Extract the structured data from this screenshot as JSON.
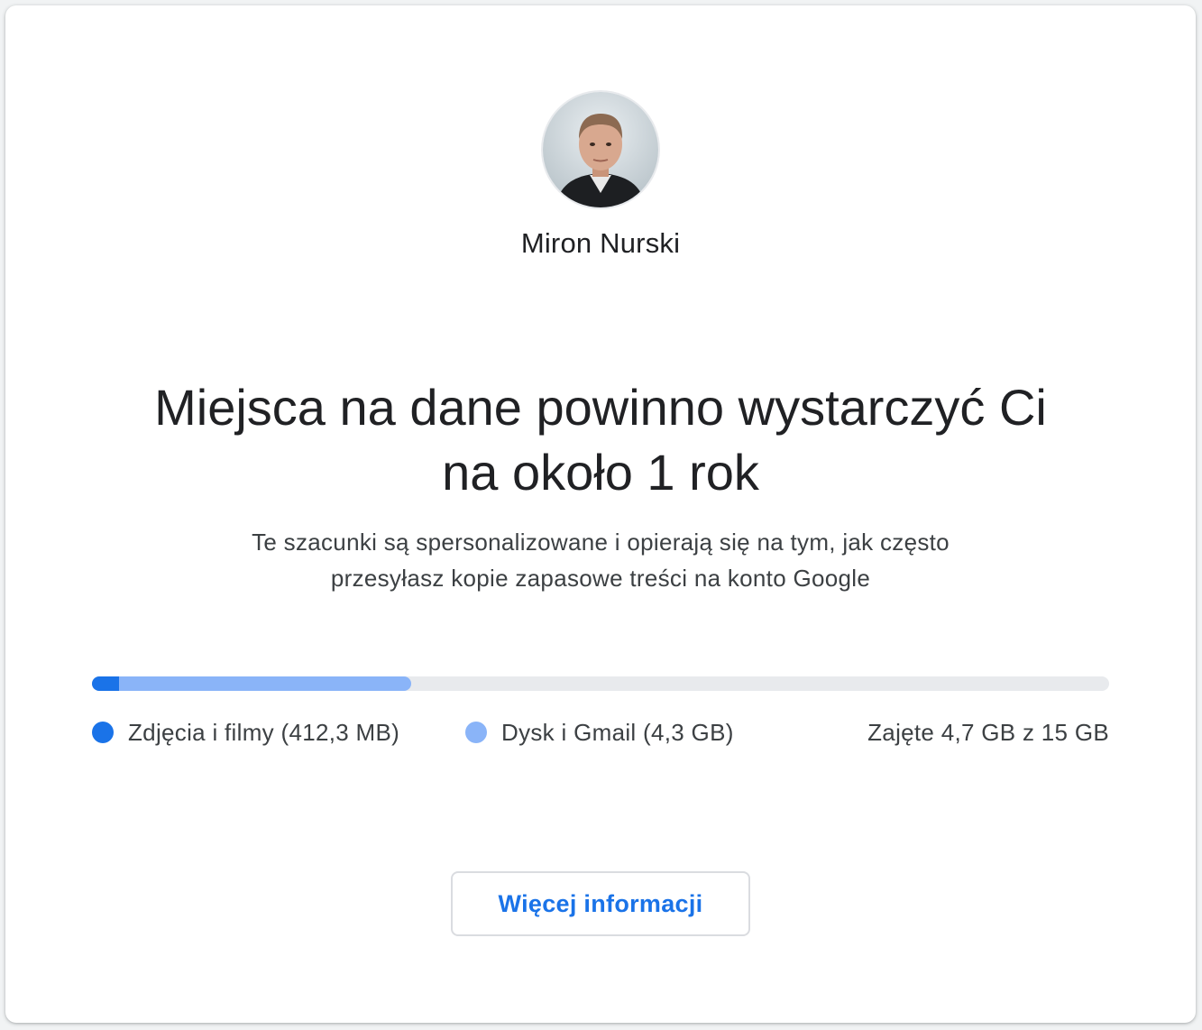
{
  "account": {
    "name": "Miron Nurski"
  },
  "estimate": {
    "headline_line1": "Miejsca na dane powinno wystarczyć Ci",
    "headline_line2": "na około 1 rok",
    "description_line1": "Te szacunki są spersonalizowane i opierają się na tym, jak często",
    "description_line2": "przesyłasz kopie zapasowe treści na konto Google"
  },
  "storage": {
    "total_gb": 15,
    "segments": [
      {
        "label": "Zdjęcia i filmy (412,3 MB)",
        "fraction": 0.027,
        "color": "#1a73e8"
      },
      {
        "label": "Dysk i Gmail (4,3 GB)",
        "fraction": 0.287,
        "color": "#8ab4f8"
      }
    ],
    "track_color": "#e8eaed",
    "used_summary": "Zajęte 4,7 GB z 15 GB"
  },
  "actions": {
    "more_info_label": "Więcej informacji"
  },
  "colors": {
    "accent": "#1a73e8",
    "text_primary": "#202124",
    "text_secondary": "#3c4043"
  }
}
